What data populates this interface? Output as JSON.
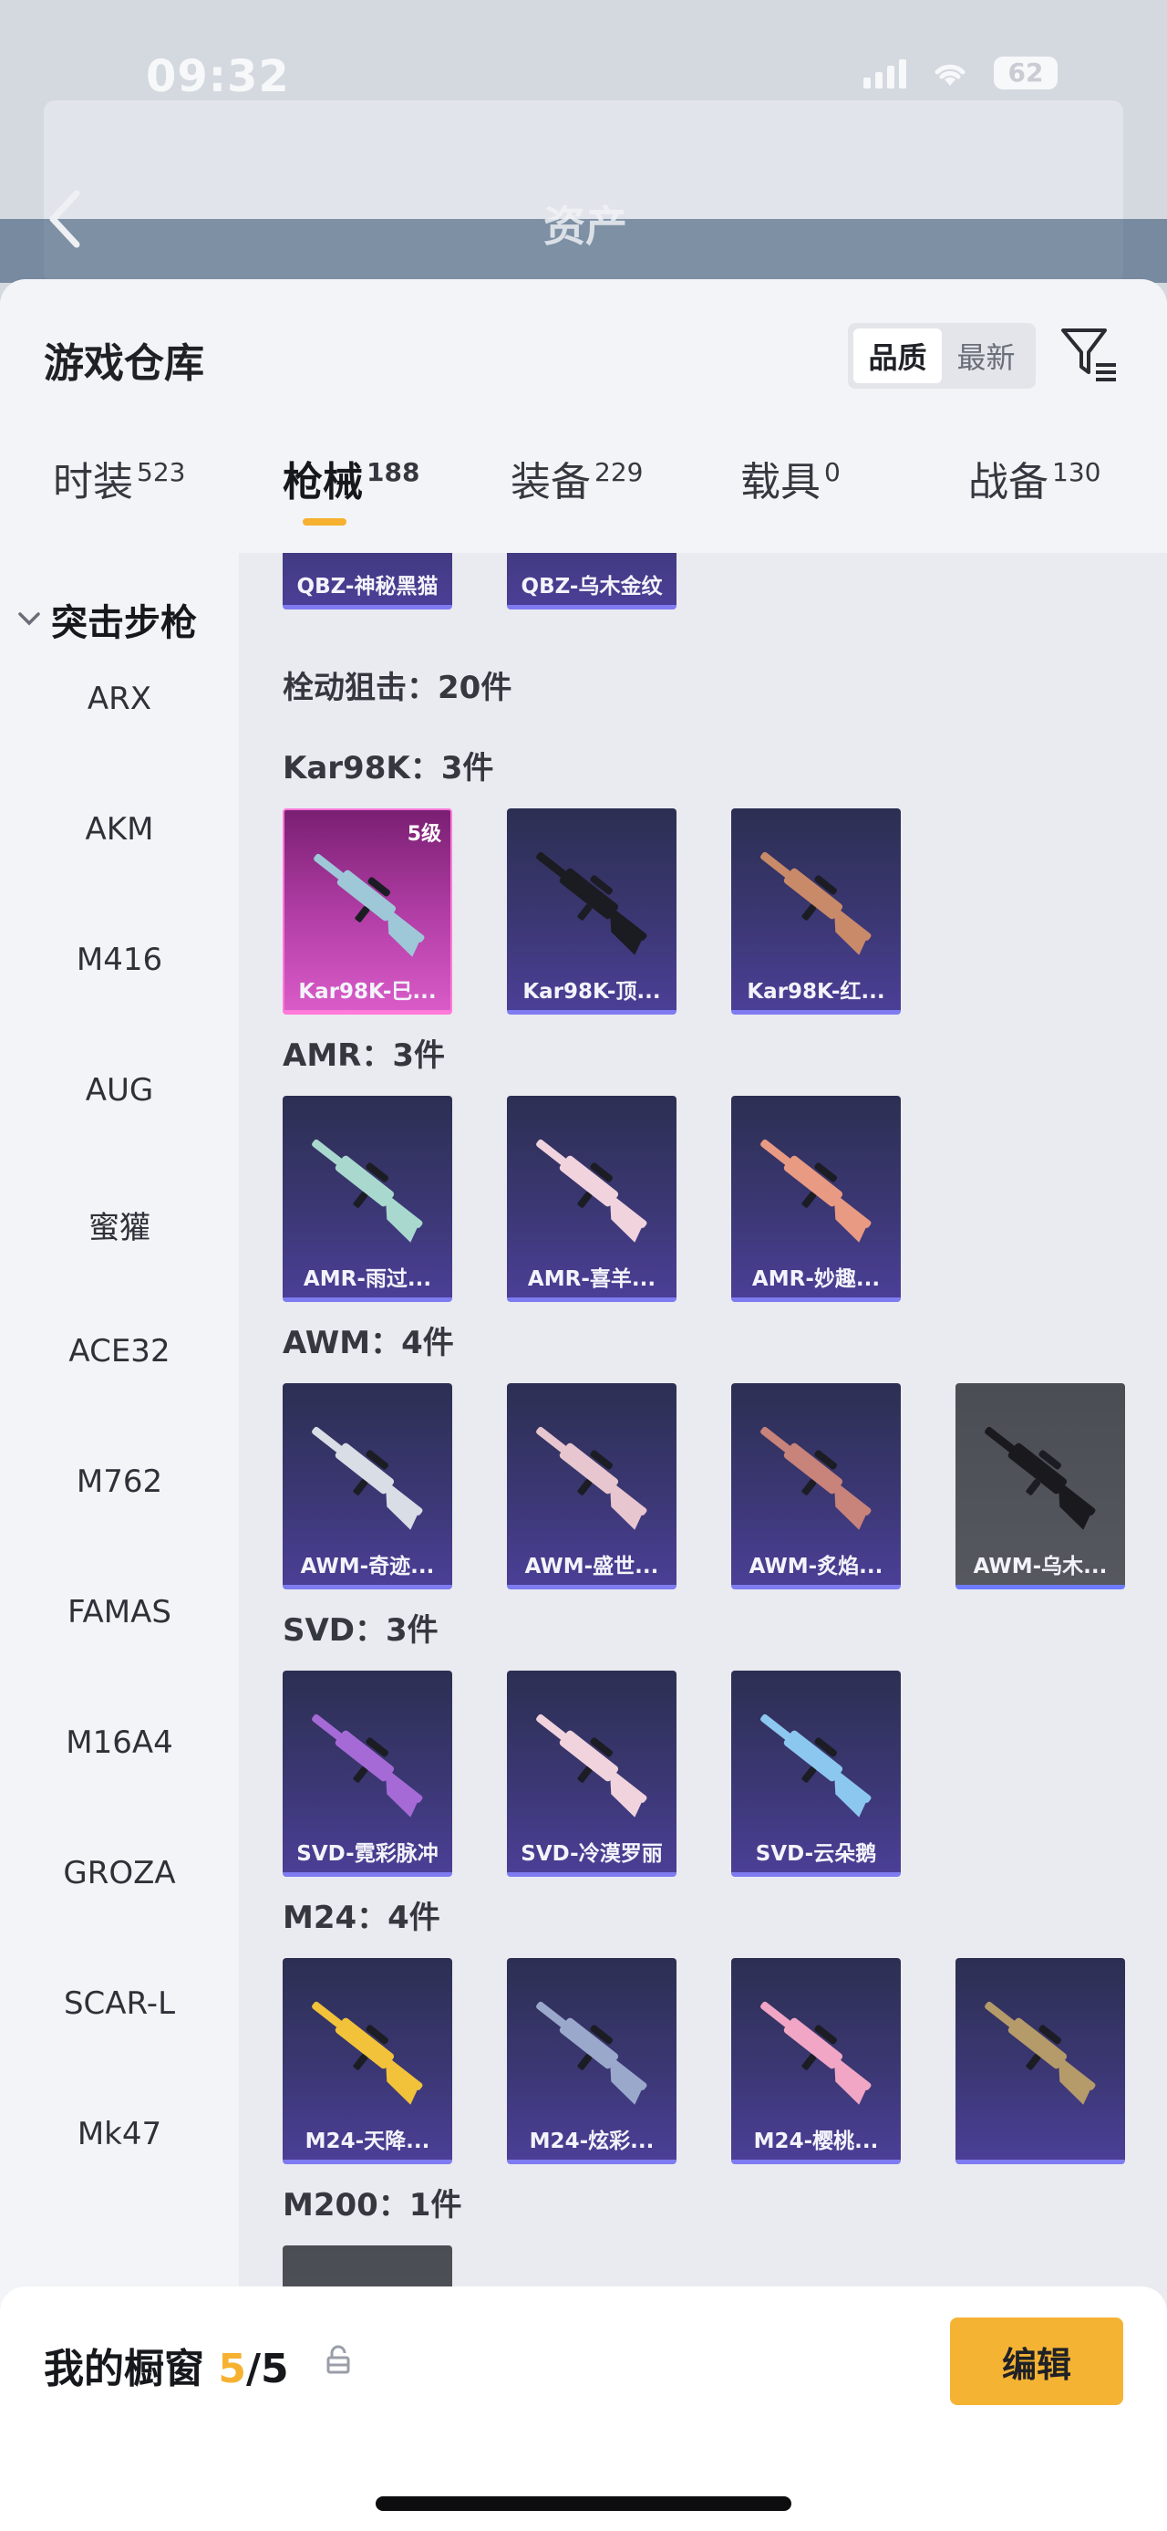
{
  "status_bar": {
    "time": "09:32",
    "battery": "62"
  },
  "background_page": {
    "title": "资产"
  },
  "sheet": {
    "title": "游戏仓库",
    "sort_options": [
      "品质",
      "最新"
    ],
    "tabs": [
      {
        "label": "时装",
        "count": "523"
      },
      {
        "label": "枪械",
        "count": "188"
      },
      {
        "label": "装备",
        "count": "229"
      },
      {
        "label": "载具",
        "count": "0"
      },
      {
        "label": "战备",
        "count": "130"
      }
    ],
    "side_nav": {
      "heading": "突击步枪",
      "items": [
        "ARX",
        "AKM",
        "M416",
        "AUG",
        "蜜獾",
        "ACE32",
        "M762",
        "FAMAS",
        "M16A4",
        "GROZA",
        "SCAR-L",
        "Mk47"
      ]
    },
    "content": {
      "top_cards": [
        "QBZ-神秘黑猫",
        "QBZ-乌木金纹"
      ],
      "section_title": "栓动狙击：20件",
      "groups": [
        {
          "title": "Kar98K：3件",
          "items": [
            {
              "name": "Kar98K-巳...",
              "badge": "5级",
              "style": "pink",
              "gun": "#9ec8d8"
            },
            {
              "name": "Kar98K-顶...",
              "style": "purple",
              "gun": "#1b1c22"
            },
            {
              "name": "Kar98K-红...",
              "style": "purple",
              "gun": "#c98a6a"
            }
          ]
        },
        {
          "title": "AMR：3件",
          "items": [
            {
              "name": "AMR-雨过...",
              "style": "purple",
              "gun": "#a9d8cf"
            },
            {
              "name": "AMR-喜羊...",
              "style": "purple",
              "gun": "#f1d3de"
            },
            {
              "name": "AMR-妙趣...",
              "style": "purple",
              "gun": "#e99a82"
            }
          ]
        },
        {
          "title": "AWM：4件",
          "items": [
            {
              "name": "AWM-奇迹...",
              "style": "purple",
              "gun": "#d8dde6"
            },
            {
              "name": "AWM-盛世...",
              "style": "purple",
              "gun": "#e7c6cf"
            },
            {
              "name": "AWM-炙焰...",
              "style": "purple",
              "gun": "#c8837a"
            },
            {
              "name": "AWM-乌木...",
              "style": "gray",
              "gun": "#1a1a1e"
            }
          ]
        },
        {
          "title": "SVD：3件",
          "items": [
            {
              "name": "SVD-霓彩脉冲",
              "style": "purple",
              "gun": "#a66ad6"
            },
            {
              "name": "SVD-冷漠罗丽",
              "style": "purple",
              "gun": "#f0d3dc"
            },
            {
              "name": "SVD-云朵鹅",
              "style": "purple",
              "gun": "#8cc7ef"
            }
          ]
        },
        {
          "title": "M24：4件",
          "items": [
            {
              "name": "M24-天降...",
              "style": "purple",
              "gun": "#f1c23a"
            },
            {
              "name": "M24-炫彩...",
              "style": "purple",
              "gun": "#9aa8cc"
            },
            {
              "name": "M24-樱桃...",
              "style": "purple",
              "gun": "#f0a6c4"
            },
            {
              "name": "",
              "style": "purple",
              "gun": "#b59a6a"
            }
          ]
        },
        {
          "title": "M200：1件",
          "items": [
            {
              "name": "",
              "style": "gray",
              "gun": "#2a2a2e"
            }
          ]
        }
      ]
    }
  },
  "bottom_bar": {
    "label": "我的橱窗",
    "current": "5",
    "total": "/5",
    "edit_label": "编辑"
  },
  "colors": {
    "accent": "#f5b12f",
    "card_purple": "#3b3773",
    "card_pink": "#c24bb5"
  }
}
